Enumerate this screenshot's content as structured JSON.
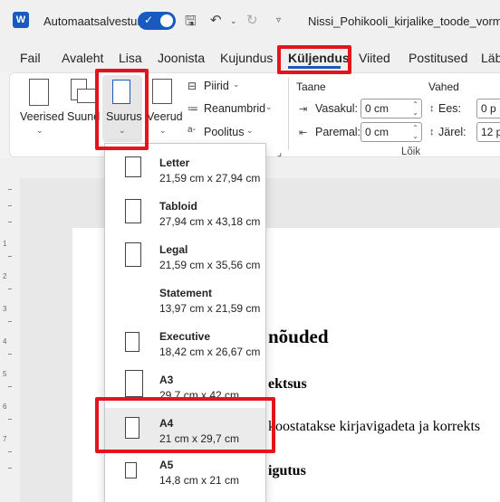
{
  "titlebar": {
    "autosave_label": "Automaatsalvestus",
    "doc_title": "Nissi_Pohikooli_kirjalike_toode_vormista"
  },
  "tabs": [
    "Fail",
    "Avaleht",
    "Lisa",
    "Joonista",
    "Kujundus",
    "Küljendus",
    "Viited",
    "Postitused",
    "Läb"
  ],
  "ribbon": {
    "veerised": "Veerised",
    "suund": "Suund",
    "suurus": "Suurus",
    "veerud": "Veerud",
    "piirid": "Piirid",
    "reanumbrid": "Reanumbrid",
    "poolitus": "Poolitus",
    "taane_label": "Taane",
    "vahed_label": "Vahed",
    "vasakul": "Vasakul:",
    "paremal": "Paremal:",
    "ees": "Ees:",
    "jarel": "Järel:",
    "vasakul_value": "0 cm",
    "paremal_value": "0 cm",
    "ees_value": "0 p",
    "jarel_value": "12 p",
    "loik_label": "Lõik"
  },
  "sizes": [
    {
      "name": "Letter",
      "dims": "21,59 cm x 27,94 cm"
    },
    {
      "name": "Tabloid",
      "dims": "27,94 cm x 43,18 cm"
    },
    {
      "name": "Legal",
      "dims": "21,59 cm x 35,56 cm"
    },
    {
      "name": "Statement",
      "dims": "13,97 cm x 21,59 cm"
    },
    {
      "name": "Executive",
      "dims": "18,42 cm x 26,67 cm"
    },
    {
      "name": "A3",
      "dims": "29,7 cm x 42 cm"
    },
    {
      "name": "A4",
      "dims": "21 cm x 29,7 cm"
    },
    {
      "name": "A5",
      "dims": "14,8 cm x 21 cm"
    }
  ],
  "document": {
    "heading": "nõuded",
    "line1": "ektsus",
    "line2": "koostatakse kirjavigadeta ja korrekts",
    "line3": "igutus"
  },
  "ruler_numbers": [
    "1",
    "2",
    "3",
    "4",
    "5",
    "6",
    "7"
  ],
  "colors": {
    "accent": "#185abd",
    "highlight": "#e3141b"
  }
}
